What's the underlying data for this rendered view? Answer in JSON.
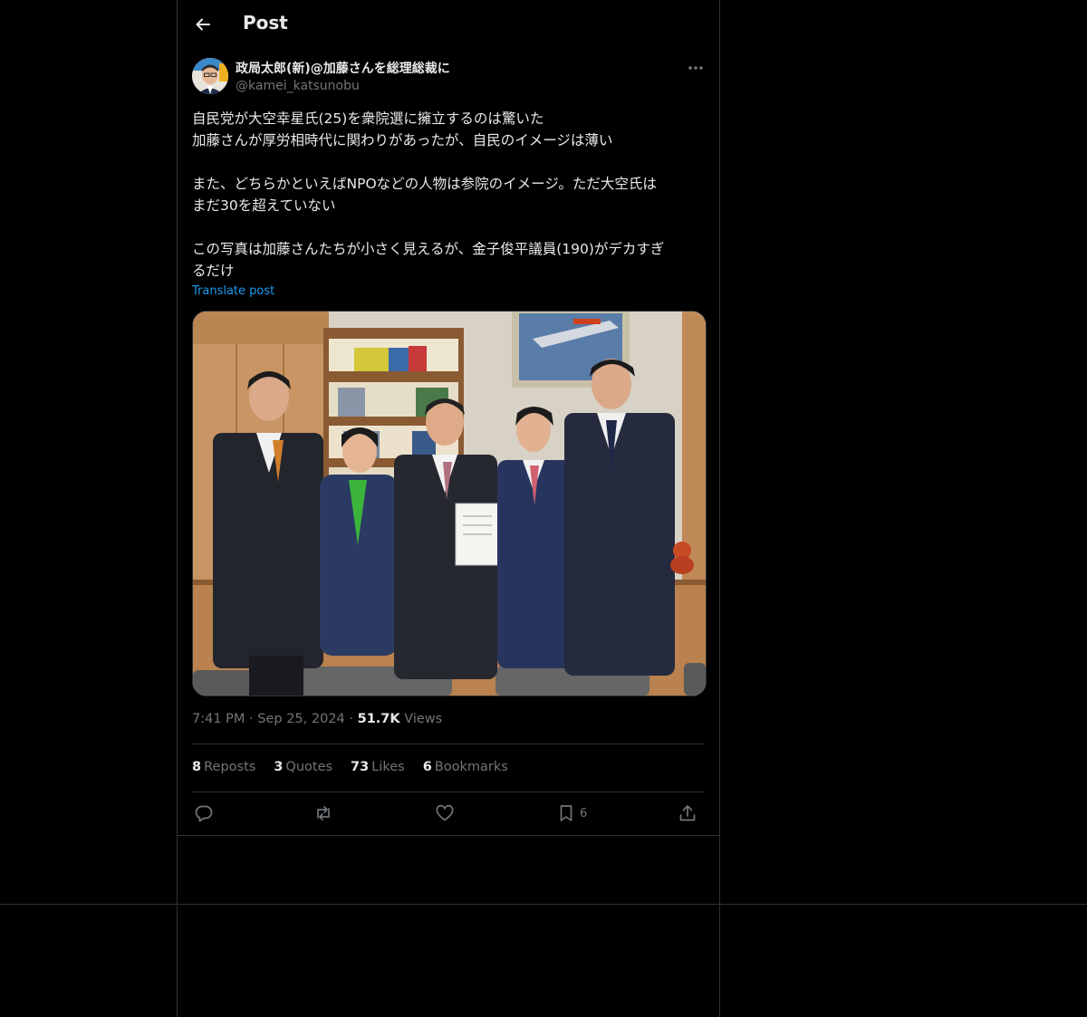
{
  "header": {
    "title": "Post"
  },
  "author": {
    "name": "政局太郎(新)@加藤さんを総理総裁に",
    "handle": "@kamei_katsunobu"
  },
  "post": {
    "text": "自民党が大空幸星氏(25)を衆院選に擁立するのは驚いた\n加藤さんが厚労相時代に関わりがあったが、自民のイメージは薄い\n\nまた、どちらかといえばNPOなどの人物は参院のイメージ。ただ大空氏は\nまだ30を超えていない\n\nこの写真は加藤さんたちが小さく見えるが、金子俊平議員(190)がデカすぎ\nるだけ",
    "translate_label": "Translate post"
  },
  "meta": {
    "time": "7:41 PM",
    "separator": "·",
    "date": "Sep 25, 2024",
    "views_count": "51.7K",
    "views_label": "Views"
  },
  "stats": {
    "reposts_count": "8",
    "reposts_label": "Reposts",
    "quotes_count": "3",
    "quotes_label": "Quotes",
    "likes_count": "73",
    "likes_label": "Likes",
    "bookmarks_count": "6",
    "bookmarks_label": "Bookmarks"
  },
  "actions": {
    "bookmark_count": "6"
  },
  "icons": {
    "back": "arrow-left-icon",
    "more": "more-horizontal-icon",
    "reply": "reply-icon",
    "repost": "repost-icon",
    "like": "heart-icon",
    "bookmark": "bookmark-icon",
    "share": "share-icon"
  },
  "colors": {
    "background": "#000000",
    "text": "#e7e9ea",
    "muted": "#71767b",
    "link": "#1d9bf0",
    "border": "#2f3336"
  }
}
